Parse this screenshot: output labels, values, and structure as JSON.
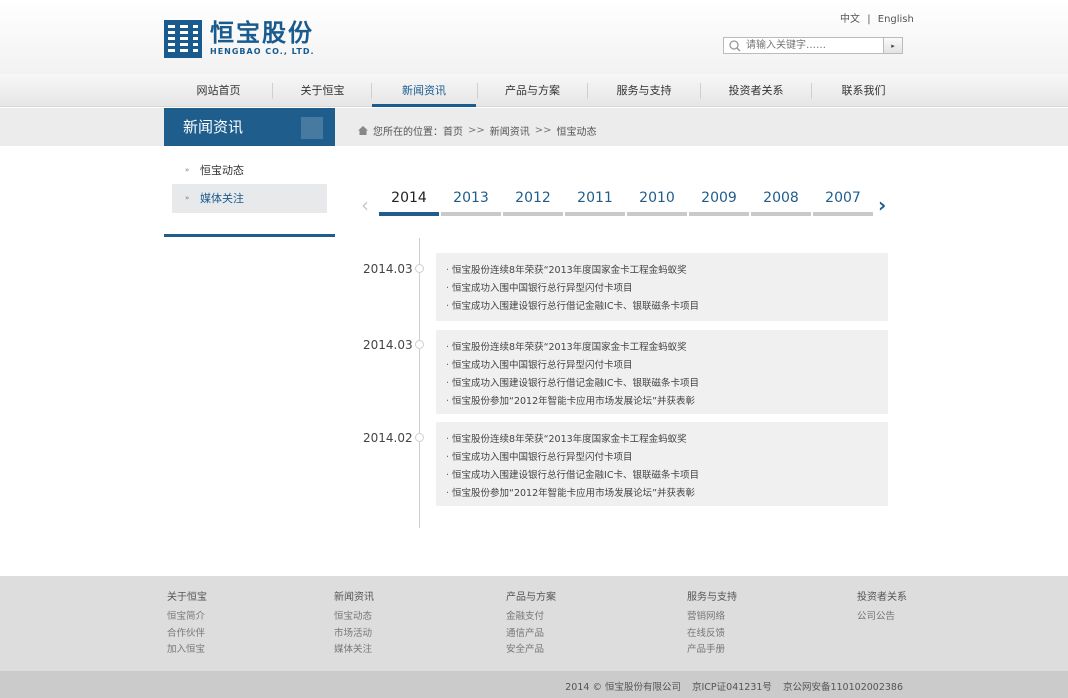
{
  "brand": {
    "cn": "恒宝股份",
    "en": "HENGBAO CO., LTD.",
    "color": "#1a5b8f"
  },
  "lang": {
    "cn": "中文",
    "sep": "|",
    "en": "English"
  },
  "search": {
    "placeholder": "请输入关键字……",
    "button": "▸"
  },
  "nav": [
    {
      "label": "网站首页"
    },
    {
      "label": "关于恒宝"
    },
    {
      "label": "新闻资讯",
      "active": true
    },
    {
      "label": "产品与方案"
    },
    {
      "label": "服务与支持"
    },
    {
      "label": "投资者关系"
    },
    {
      "label": "联系我们"
    }
  ],
  "section_title": "新闻资讯",
  "breadcrumb": {
    "prefix": "您所在的位置：",
    "items": [
      "首页",
      "新闻资讯",
      "恒宝动态"
    ],
    "sep": ">>"
  },
  "sidebar": [
    {
      "label": "恒宝动态"
    },
    {
      "label": "媒体关注",
      "active": true
    }
  ],
  "years": {
    "prev": "‹",
    "next": "›",
    "items": [
      "2014",
      "2013",
      "2012",
      "2011",
      "2010",
      "2009",
      "2008",
      "2007"
    ],
    "active": "2014"
  },
  "timeline": [
    {
      "date": "2014.03",
      "items": [
        "恒宝股份连续8年荣获“2013年度国家金卡工程金蚂蚁奖",
        "恒宝成功入围中国银行总行异型闪付卡项目",
        "恒宝成功入围建设银行总行借记金融IC卡、银联磁条卡项目"
      ]
    },
    {
      "date": "2014.03",
      "items": [
        "恒宝股份连续8年荣获“2013年度国家金卡工程金蚂蚁奖",
        "恒宝成功入围中国银行总行异型闪付卡项目",
        "恒宝成功入围建设银行总行借记金融IC卡、银联磁条卡项目",
        "恒宝股份参加“2012年智能卡应用市场发展论坛”并获表彰"
      ]
    },
    {
      "date": "2014.02",
      "items": [
        "恒宝股份连续8年荣获“2013年度国家金卡工程金蚂蚁奖",
        "恒宝成功入围中国银行总行异型闪付卡项目",
        "恒宝成功入围建设银行总行借记金融IC卡、银联磁条卡项目",
        "恒宝股份参加“2012年智能卡应用市场发展论坛”并获表彰"
      ]
    }
  ],
  "footer": [
    {
      "heading": "关于恒宝",
      "links": [
        "恒宝简介",
        "合作伙伴",
        "加入恒宝"
      ]
    },
    {
      "heading": "新闻资讯",
      "links": [
        "恒宝动态",
        "市场活动",
        "媒体关注"
      ]
    },
    {
      "heading": "产品与方案",
      "links": [
        "金融支付",
        "通信产品",
        "安全产品"
      ]
    },
    {
      "heading": "服务与支持",
      "links": [
        "营销网络",
        "在线反馈",
        "产品手册"
      ]
    },
    {
      "heading": "投资者关系",
      "links": [
        "公司公告"
      ]
    }
  ],
  "copyright": {
    "text": "2014 © 恒宝股份有限公司",
    "icp": "京ICP证041231号",
    "police": "京公网安备110102002386"
  }
}
